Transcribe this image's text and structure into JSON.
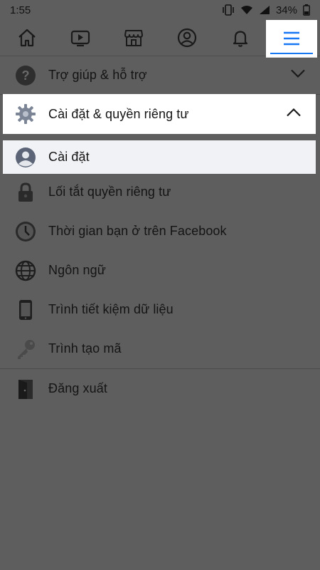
{
  "status_bar": {
    "time": "1:55",
    "battery": "34%"
  },
  "nav": {
    "tabs": [
      {
        "name": "home"
      },
      {
        "name": "watch"
      },
      {
        "name": "marketplace"
      },
      {
        "name": "profile"
      },
      {
        "name": "notifications"
      },
      {
        "name": "menu"
      }
    ]
  },
  "menu": {
    "help": {
      "label": "Trợ giúp & hỗ trợ"
    },
    "settings_privacy": {
      "label": "Cài đặt & quyền riêng tư"
    },
    "items": [
      {
        "label": "Cài đặt"
      },
      {
        "label": "Lối tắt quyền riêng tư"
      },
      {
        "label": "Thời gian bạn ở trên Facebook"
      },
      {
        "label": "Ngôn ngữ"
      },
      {
        "label": "Trình tiết kiệm dữ liệu"
      },
      {
        "label": "Trình tạo mã"
      }
    ],
    "logout": {
      "label": "Đăng xuất"
    }
  },
  "colors": {
    "accent": "#1877f2",
    "overlay": "#5e5e5e",
    "highlight_bg": "#ffffff",
    "sub_bg": "#f1f2f6"
  }
}
